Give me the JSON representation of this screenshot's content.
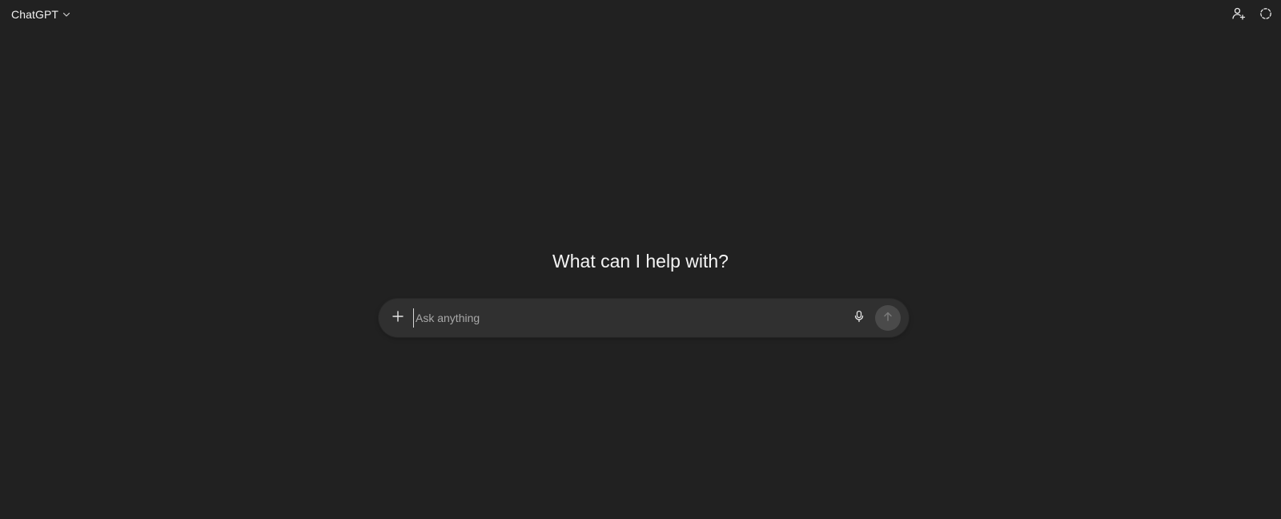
{
  "header": {
    "model_label": "ChatGPT",
    "model_chevron_icon": "chevron-down-icon",
    "actions": [
      {
        "name": "add-people-icon"
      },
      {
        "name": "temporary-chat-icon"
      }
    ]
  },
  "main": {
    "headline": "What can I help with?"
  },
  "composer": {
    "placeholder": "Ask anything",
    "value": "",
    "add_icon": "plus-icon",
    "mic_icon": "microphone-icon",
    "send_icon": "arrow-up-icon"
  },
  "colors": {
    "background": "#212121",
    "composer_bg": "#303030",
    "send_button_disabled": "#4a4a4a",
    "text_primary": "#ececec",
    "placeholder": "#a8a8a8"
  }
}
